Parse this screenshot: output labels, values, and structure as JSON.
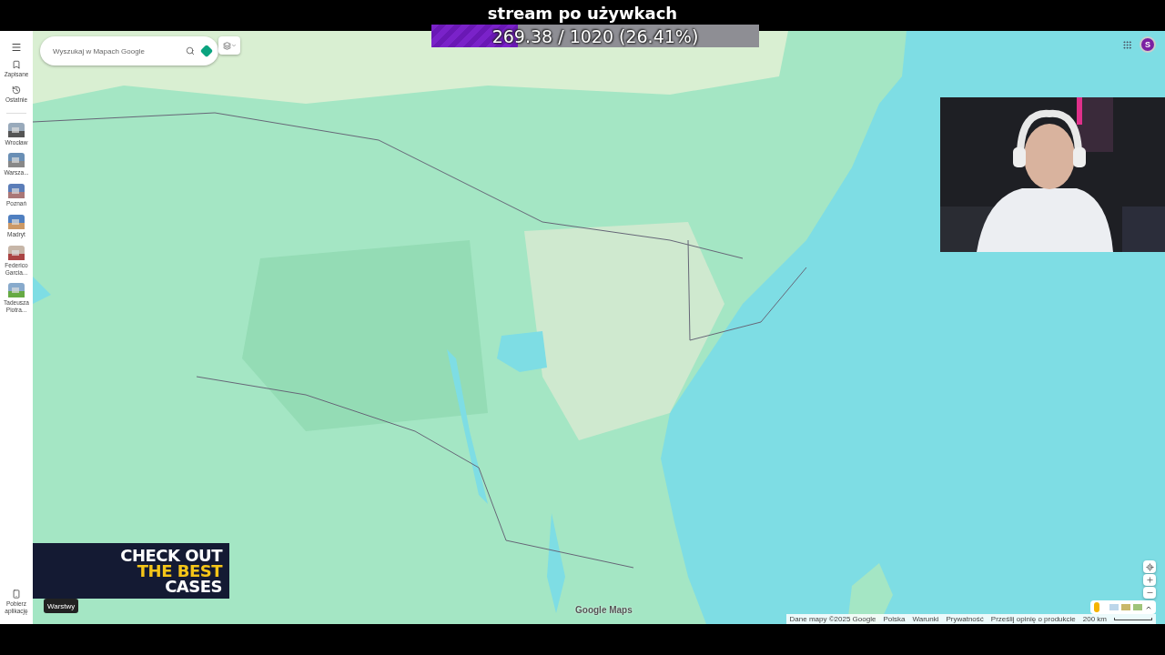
{
  "overlay": {
    "title": "stream po używkach",
    "progress": {
      "text": "269.38 / 1020 (26.41%)",
      "level": 0.2641
    }
  },
  "sidebar": {
    "items": [
      {
        "label": "Zapisane",
        "kind": "saved"
      },
      {
        "label": "Ostatnie",
        "kind": "recent"
      }
    ],
    "recent_places": [
      {
        "label": "Wrocław"
      },
      {
        "label": "Warsza..."
      },
      {
        "label": "Poznań"
      },
      {
        "label": "Madryt"
      },
      {
        "label": "Federico Garcia..."
      },
      {
        "label": "Tadeusza Piotra..."
      }
    ],
    "app_link": "Pobierz aplikację"
  },
  "search": {
    "placeholder": "Wyszukaj w Mapach Google"
  },
  "account": {
    "initial": "S"
  },
  "layers": {
    "label": "Warstwy"
  },
  "ad": {
    "lines": [
      {
        "text": "CHECK OUT",
        "highlight": false
      },
      {
        "text": "THE BEST",
        "highlight": true
      },
      {
        "text": "CASES",
        "highlight": false
      }
    ]
  },
  "logo": "Google Maps",
  "footer": {
    "links": [
      "Dane mapy ©2025 Google",
      "Polska",
      "Warunki",
      "Prywatność",
      "Prześlij opinię o produkcie"
    ],
    "scale": "200 km"
  }
}
